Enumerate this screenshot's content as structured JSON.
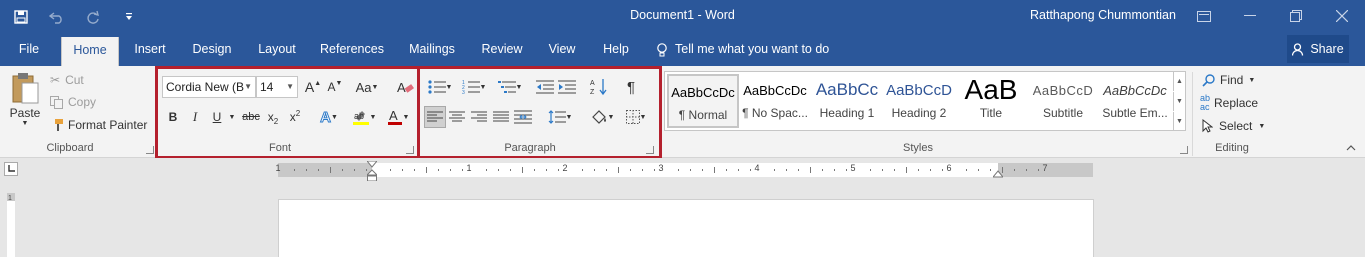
{
  "titlebar": {
    "document_title": "Document1  -  Word",
    "user_name": "Ratthapong Chummontian",
    "save_icon": "save-icon",
    "undo_icon": "undo-icon",
    "redo_icon": "redo-icon",
    "customize_icon": "customize-qat-icon"
  },
  "tabs": [
    "File",
    "Home",
    "Insert",
    "Design",
    "Layout",
    "References",
    "Mailings",
    "Review",
    "View",
    "Help"
  ],
  "active_tab": "Home",
  "tellme": {
    "placeholder": "Tell me what you want to do"
  },
  "share": {
    "label": "Share"
  },
  "clipboard": {
    "paste": "Paste",
    "cut": "Cut",
    "copy": "Copy",
    "format_painter": "Format Painter",
    "label": "Clipboard"
  },
  "font": {
    "name": "Cordia New (B",
    "size": "14",
    "label": "Font",
    "bold": "B",
    "italic": "I",
    "underline": "U",
    "strikethrough": "abc",
    "change_case": "Aa"
  },
  "paragraph": {
    "label": "Paragraph"
  },
  "styles": {
    "label": "Styles",
    "items": [
      {
        "preview": "AaBbCcDc",
        "name": "¶ Normal"
      },
      {
        "preview": "AaBbCcDc",
        "name": "¶ No Spac..."
      },
      {
        "preview": "AaBbCc",
        "name": "Heading 1"
      },
      {
        "preview": "AaBbCcD",
        "name": "Heading 2"
      },
      {
        "preview": "AaB",
        "name": "Title"
      },
      {
        "preview": "AaBbCcD",
        "name": "Subtitle"
      },
      {
        "preview": "AaBbCcDc",
        "name": "Subtle Em..."
      }
    ]
  },
  "editing": {
    "find": "Find",
    "replace": "Replace",
    "select": "Select",
    "label": "Editing"
  },
  "ruler": {
    "numbers": [
      "1",
      "1",
      "2",
      "3",
      "4",
      "5",
      "6",
      "7"
    ]
  },
  "colors": {
    "accent": "#2b579a",
    "highlight_box": "#b4202d",
    "highlight_yellow": "#ffff00",
    "font_red": "#c00000"
  }
}
